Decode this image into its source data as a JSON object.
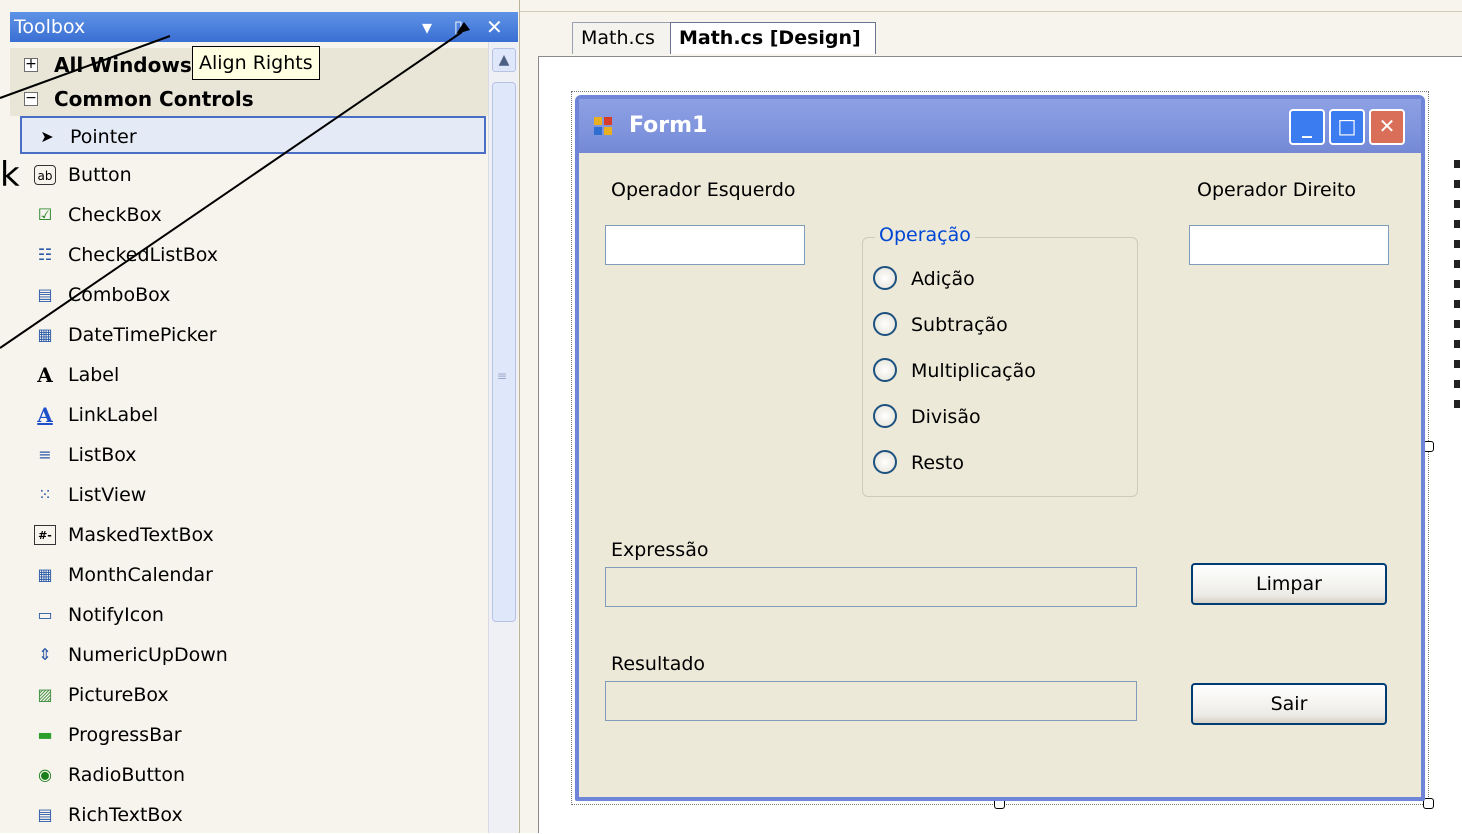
{
  "toolbox": {
    "title": "Toolbox",
    "controls": {
      "dropdown": "▾",
      "pin": "📌",
      "close": "✕"
    },
    "categories": [
      {
        "label": "All Windows",
        "expander": "+"
      },
      {
        "label": "Common Controls",
        "expander": "−"
      }
    ],
    "items": [
      {
        "label": "Pointer",
        "icon": "pointer-icon",
        "glyph": "➤"
      },
      {
        "label": "Button",
        "icon": "button-icon",
        "glyph": "ab"
      },
      {
        "label": "CheckBox",
        "icon": "checkbox-icon",
        "glyph": "☑"
      },
      {
        "label": "CheckedListBox",
        "icon": "checkedlistbox-icon",
        "glyph": "☷"
      },
      {
        "label": "ComboBox",
        "icon": "combobox-icon",
        "glyph": "▤"
      },
      {
        "label": "DateTimePicker",
        "icon": "datetimepicker-icon",
        "glyph": "▦"
      },
      {
        "label": "Label",
        "icon": "label-icon",
        "glyph": "A"
      },
      {
        "label": "LinkLabel",
        "icon": "linklabel-icon",
        "glyph": "A"
      },
      {
        "label": "ListBox",
        "icon": "listbox-icon",
        "glyph": "≡"
      },
      {
        "label": "ListView",
        "icon": "listview-icon",
        "glyph": "⁙"
      },
      {
        "label": "MaskedTextBox",
        "icon": "maskedtextbox-icon",
        "glyph": "#-"
      },
      {
        "label": "MonthCalendar",
        "icon": "monthcalendar-icon",
        "glyph": "▦"
      },
      {
        "label": "NotifyIcon",
        "icon": "notifyicon-icon",
        "glyph": "▭"
      },
      {
        "label": "NumericUpDown",
        "icon": "numericupdown-icon",
        "glyph": "⇕"
      },
      {
        "label": "PictureBox",
        "icon": "picturebox-icon",
        "glyph": "▨"
      },
      {
        "label": "ProgressBar",
        "icon": "progressbar-icon",
        "glyph": "▬"
      },
      {
        "label": "RadioButton",
        "icon": "radiobutton-icon",
        "glyph": "◉"
      },
      {
        "label": "RichTextBox",
        "icon": "richtextbox-icon",
        "glyph": "▤"
      }
    ],
    "selected": "Pointer",
    "tooltip": "Align Rights"
  },
  "tabs": [
    {
      "label": "Math.cs"
    },
    {
      "label": "Math.cs [Design]"
    }
  ],
  "form": {
    "title": "Form1",
    "window_buttons": {
      "minimize": "_",
      "maximize": "□",
      "close": "✕"
    },
    "left_operand_label": "Operador  Esquerdo",
    "right_operand_label": "Operador Direito",
    "left_operand_value": "",
    "right_operand_value": "",
    "operation_group": "Operação",
    "operations": [
      "Adição",
      "Subtração",
      "Multiplicação",
      "Divisão",
      "Resto"
    ],
    "expression_label": "Expressão",
    "expression_value": "",
    "result_label": "Resultado",
    "result_value": "",
    "clear_button": "Limpar",
    "exit_button": "Sair"
  },
  "colors": {
    "titlebar": "#3a6fd3",
    "form_border": "#6f86d8",
    "group_legend": "#0046d5",
    "selection": "#4a6ec4"
  }
}
